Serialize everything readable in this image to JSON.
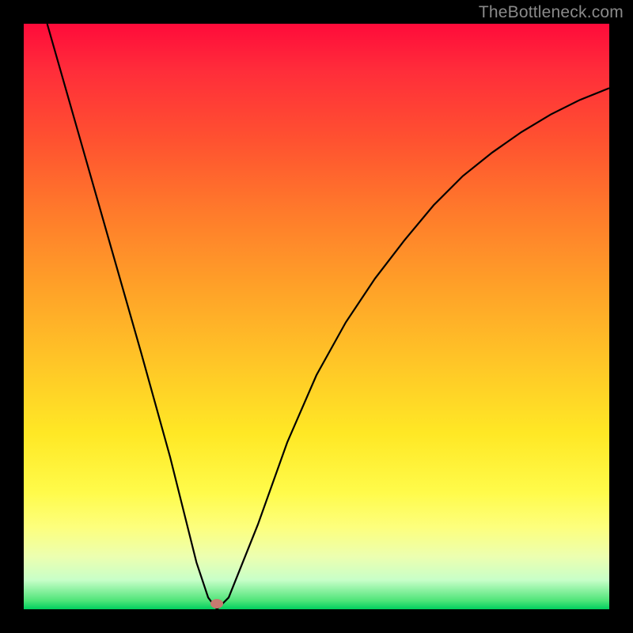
{
  "watermark": "TheBottleneck.com",
  "chart_data": {
    "type": "line",
    "title": "",
    "xlabel": "",
    "ylabel": "",
    "xlim": [
      0,
      1
    ],
    "ylim": [
      0,
      1
    ],
    "grid": false,
    "series": [
      {
        "name": "curve",
        "x": [
          0.04,
          0.09,
          0.15,
          0.2,
          0.25,
          0.295,
          0.315,
          0.33,
          0.35,
          0.4,
          0.45,
          0.5,
          0.55,
          0.6,
          0.65,
          0.7,
          0.75,
          0.8,
          0.85,
          0.9,
          0.95,
          1.0
        ],
        "y": [
          1.0,
          0.825,
          0.615,
          0.44,
          0.26,
          0.08,
          0.02,
          0.0,
          0.02,
          0.145,
          0.285,
          0.4,
          0.49,
          0.565,
          0.63,
          0.69,
          0.74,
          0.78,
          0.815,
          0.845,
          0.87,
          0.89
        ]
      }
    ],
    "marker": {
      "x": 0.33,
      "y": 0.01
    },
    "background_gradient": {
      "top": "#ff0b3a",
      "bottom": "#00cf5e"
    }
  }
}
